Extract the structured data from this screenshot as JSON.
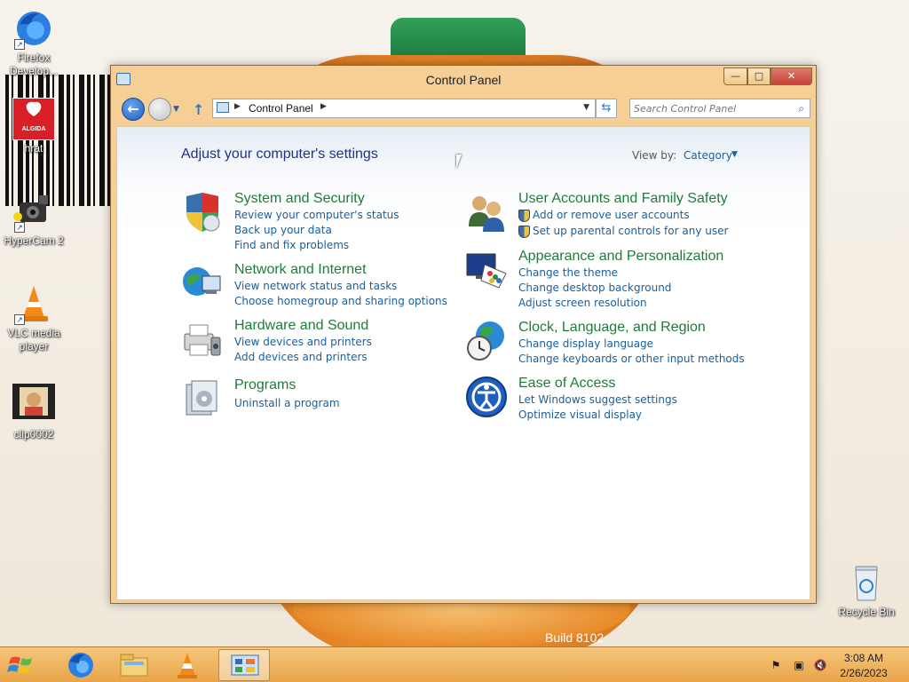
{
  "desktop": {
    "icons": [
      {
        "name": "Firefox Develop...",
        "icon": "firefox-developer-icon"
      },
      {
        "name": "hrat",
        "icon": "algida-icon"
      },
      {
        "name": "HyperCam 2",
        "icon": "hypercam-icon"
      },
      {
        "name": "VLC media player",
        "icon": "vlc-cone-icon"
      },
      {
        "name": "clip0002",
        "icon": "video-clip-icon"
      },
      {
        "name": "Recycle Bin",
        "icon": "recycle-bin-icon"
      }
    ],
    "logo_text": "ALGIDA",
    "build_text": "Build 8102"
  },
  "window": {
    "title": "Control Panel",
    "controls": {
      "minimize": "—",
      "maximize": "□",
      "close": "✕"
    },
    "nav": {
      "back_icon": "arrow-left-icon",
      "forward_icon": "arrow-right-icon",
      "up_icon": "arrow-up-icon",
      "breadcrumb": "Control Panel",
      "refresh_icon": "refresh-icon"
    },
    "search": {
      "placeholder": "Search Control Panel"
    },
    "heading": "Adjust your computer's settings",
    "view_by": {
      "label": "View by:",
      "value": "Category"
    },
    "categories": [
      {
        "title": "System and Security",
        "icon": "shield-icon",
        "links": [
          "Review your computer's status",
          "Back up your data",
          "Find and fix problems"
        ]
      },
      {
        "title": "Network and Internet",
        "icon": "globe-network-icon",
        "links": [
          "View network status and tasks",
          "Choose homegroup and sharing options"
        ]
      },
      {
        "title": "Hardware and Sound",
        "icon": "printer-icon",
        "links": [
          "View devices and printers",
          "Add devices and printers"
        ]
      },
      {
        "title": "Programs",
        "icon": "programs-icon",
        "links": [
          "Uninstall a program"
        ]
      },
      {
        "title": "User Accounts and Family Safety",
        "icon": "users-icon",
        "links": [
          "Add or remove user accounts",
          "Set up parental controls for any user"
        ]
      },
      {
        "title": "Appearance and Personalization",
        "icon": "monitor-palette-icon",
        "links": [
          "Change the theme",
          "Change desktop background",
          "Adjust screen resolution"
        ]
      },
      {
        "title": "Clock, Language, and Region",
        "icon": "clock-globe-icon",
        "links": [
          "Change display language",
          "Change keyboards or other input methods"
        ]
      },
      {
        "title": "Ease of Access",
        "icon": "ease-of-access-icon",
        "links": [
          "Let Windows suggest settings",
          "Optimize visual display"
        ]
      }
    ]
  },
  "taskbar": {
    "apps": [
      "windows-start-icon",
      "firefox-icon",
      "file-explorer-icon",
      "vlc-icon",
      "control-panel-icon"
    ],
    "tray": [
      "action-center-flag-icon",
      "network-icon",
      "volume-muted-icon"
    ],
    "time": "3:08 AM",
    "date": "2/26/2023"
  },
  "colors": {
    "window_frame": "#f5cf95",
    "category_title": "#1e7c3a",
    "link": "#1a5e9a",
    "heading": "#1e3287",
    "taskbar": "#e9a44a"
  }
}
